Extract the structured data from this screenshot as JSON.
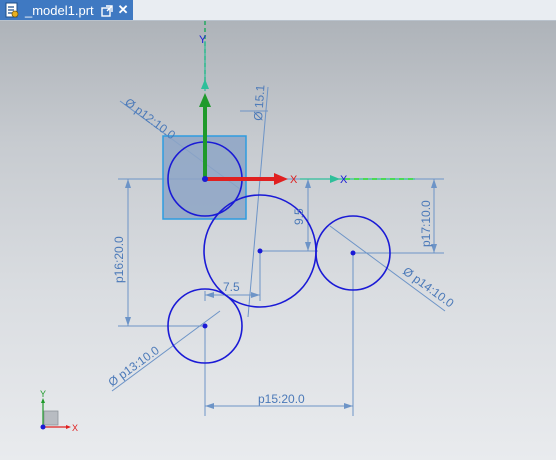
{
  "tab": {
    "title": "_model1.prt",
    "icons": {
      "file": "part-file-icon",
      "popout": "popout-icon",
      "close": "close-icon"
    }
  },
  "csys": {
    "x_label": "X",
    "y_label": "Y"
  },
  "view_triad": {
    "x_label": "X",
    "y_label": "Y"
  },
  "dimensions": {
    "p12": "Ø p12:10.0",
    "p13": "Ø p13:10.0",
    "p14": "Ø p14:10.0",
    "p15_diameter": "Ø 15.1",
    "p15": "p15:20.0",
    "p16": "p16:20.0",
    "p17": "p17:10.0",
    "vertical_offset": "9.5",
    "horizontal_offset": "7.5"
  },
  "colors": {
    "tab_active": "#3f79c2",
    "sketch_curves": "#1a1ad6",
    "dimensions": "#4b79b8",
    "x_axis": "#e02020",
    "y_axis": "#1f9a2b",
    "selection": "#2e9ce0"
  }
}
